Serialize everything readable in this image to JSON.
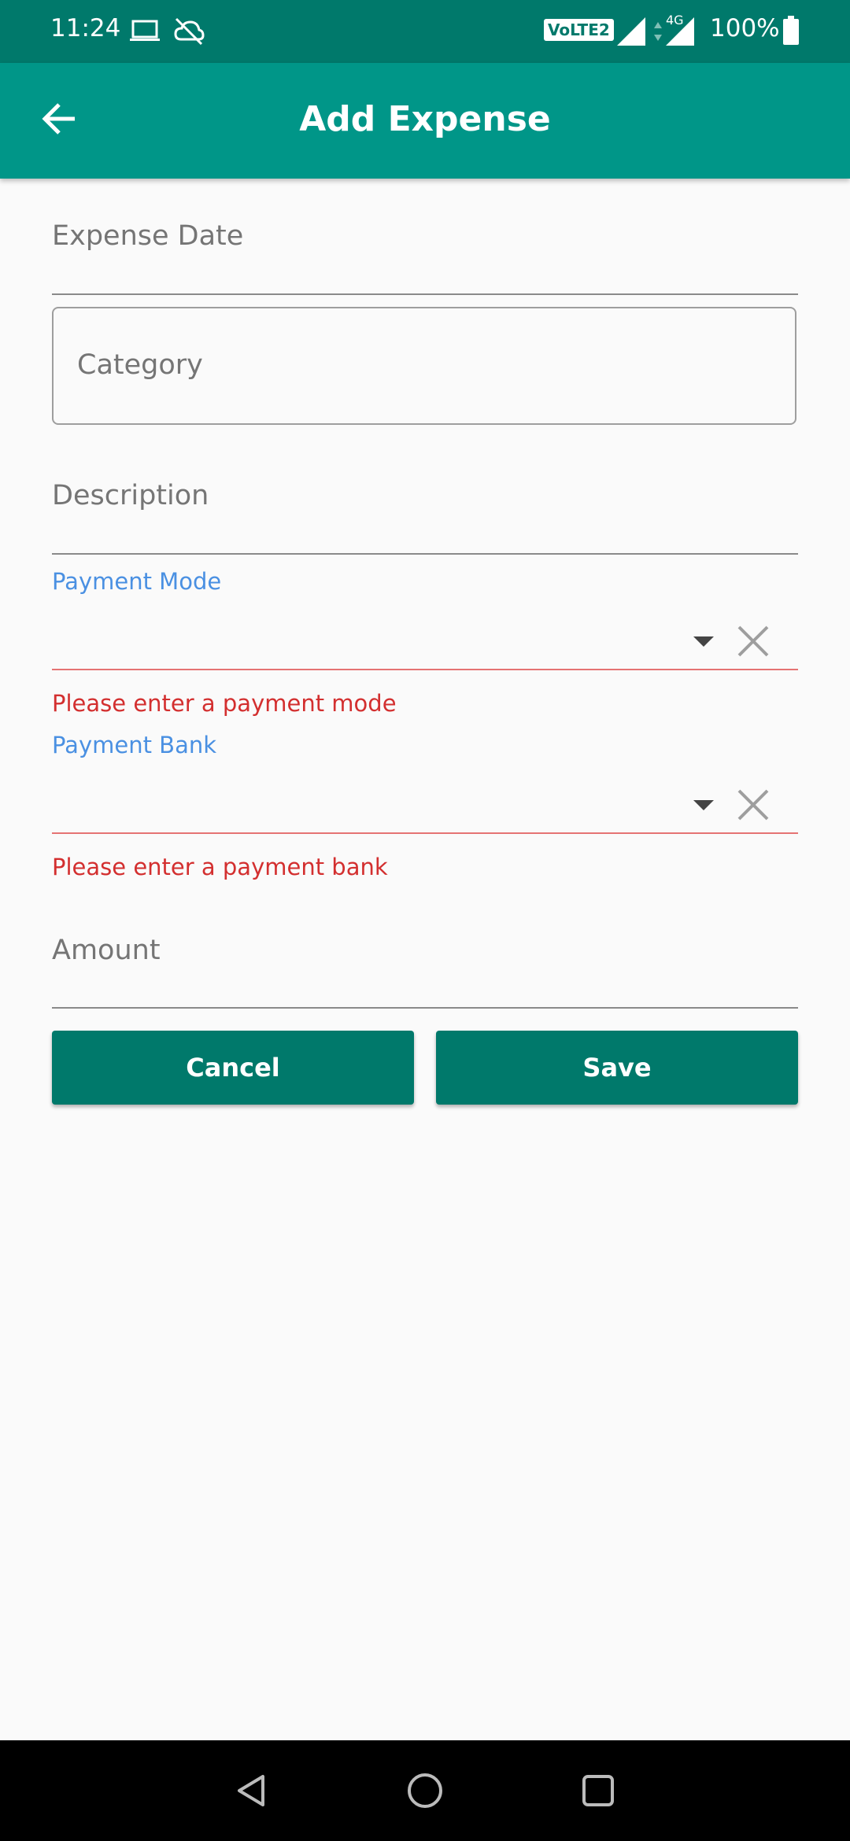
{
  "status_bar": {
    "time": "11:24",
    "network_badge": "VoLTE2",
    "network_type": "4G",
    "battery": "100%",
    "icons": [
      "laptop-icon",
      "cloud-off-icon",
      "signal-icon",
      "battery-icon"
    ]
  },
  "app_bar": {
    "title": "Add Expense",
    "back_icon": "arrow-back-icon"
  },
  "form": {
    "expense_date_placeholder": "Expense Date",
    "category_placeholder": "Category",
    "description_placeholder": "Description",
    "payment_mode_label": "Payment Mode",
    "payment_mode_error": "Please enter a payment mode",
    "payment_bank_label": "Payment Bank",
    "payment_bank_error": "Please enter a payment bank",
    "amount_placeholder": "Amount"
  },
  "actions": {
    "cancel_label": "Cancel",
    "save_label": "Save"
  },
  "colors": {
    "status_bar": "#00796b",
    "app_bar": "#009688",
    "button": "#00796b",
    "label_blue": "#4a90e2",
    "error": "#d32f2f"
  }
}
